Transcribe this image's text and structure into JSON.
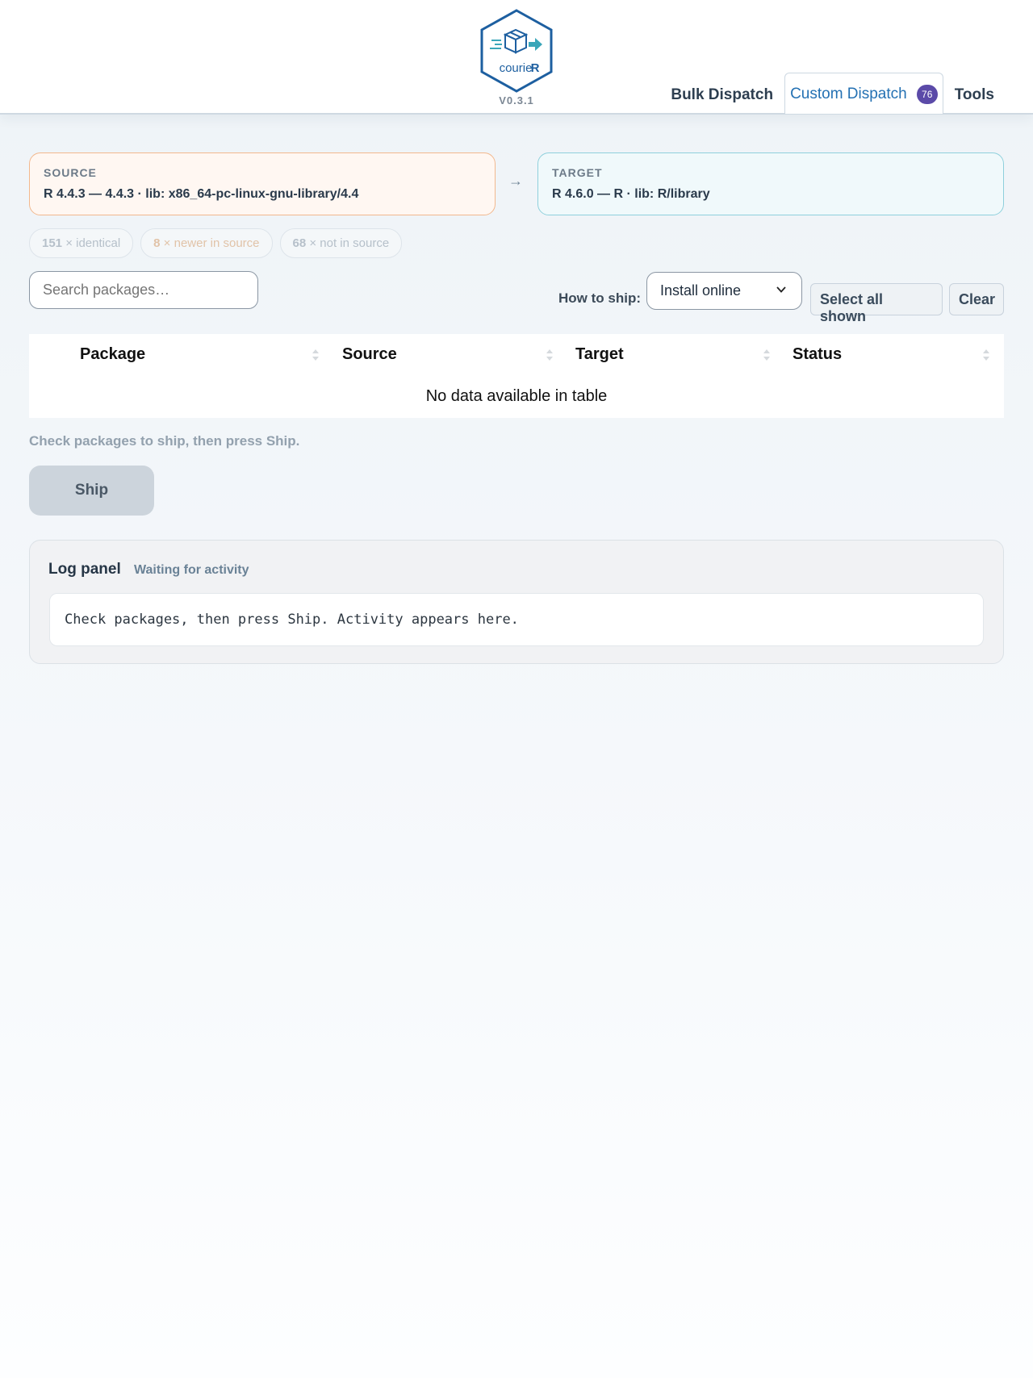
{
  "app": {
    "name": "courieR",
    "version": "V0.3.1",
    "accent_color": "#2471b3",
    "badge_color": "#5b4aa8"
  },
  "nav": {
    "items": [
      {
        "label": "Bulk Dispatch",
        "active": false
      },
      {
        "label": "Custom Dispatch",
        "active": true,
        "badge": "76"
      },
      {
        "label": "Tools",
        "active": false
      }
    ]
  },
  "source": {
    "label": "SOURCE",
    "value": "R 4.4.3 — 4.4.3 · lib: x86_64-pc-linux-gnu-library/4.4"
  },
  "target": {
    "label": "TARGET",
    "value": "R 4.6.0 — R · lib: R/library"
  },
  "arrow": "→",
  "pills": [
    {
      "count": "151",
      "text": " × identical"
    },
    {
      "count": "8",
      "text": " × newer in source"
    },
    {
      "count": "68",
      "text": " × not in source"
    }
  ],
  "search": {
    "placeholder": "Search packages…"
  },
  "ship_method": {
    "label": "How to ship:",
    "selected": "Install online"
  },
  "buttons": {
    "select_all": "Select all shown",
    "clear": "Clear",
    "ship": "Ship"
  },
  "table": {
    "columns": [
      "Package",
      "Source",
      "Target",
      "Status"
    ],
    "empty_message": "No data available in table"
  },
  "hint": "Check packages to ship, then press Ship.",
  "log": {
    "title": "Log panel",
    "status": "Waiting for activity",
    "content": "Check packages, then press Ship. Activity appears here."
  }
}
